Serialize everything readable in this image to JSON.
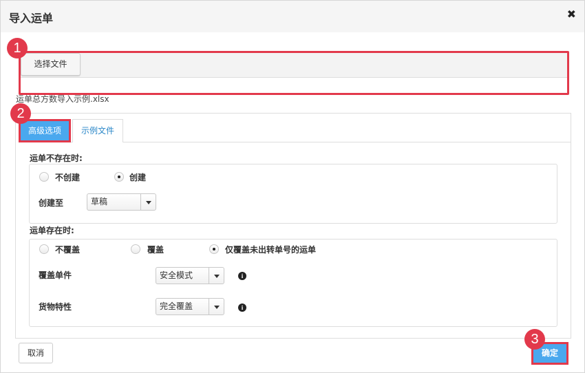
{
  "dialog": {
    "title": "导入运单",
    "close_symbol": "✖"
  },
  "file": {
    "choose_label": "选择文件",
    "file_name": "运单总方数导入示例.xlsx"
  },
  "badges": [
    "1",
    "2",
    "3"
  ],
  "tabs": [
    {
      "label": "高级选项",
      "active": true
    },
    {
      "label": "示例文件",
      "active": false
    }
  ],
  "not_exist": {
    "label": "运单不存在时:",
    "options": [
      {
        "label": "不创建",
        "checked": false
      },
      {
        "label": "创建",
        "checked": true
      }
    ],
    "create_to_label": "创建至",
    "create_to_value": "草稿"
  },
  "exist": {
    "label": "运单存在时:",
    "options": [
      {
        "label": "不覆盖",
        "checked": false
      },
      {
        "label": "覆盖",
        "checked": false
      },
      {
        "label": "仅覆盖未出转单号的运单",
        "checked": true
      }
    ],
    "cover_item_label": "覆盖单件",
    "cover_item_value": "安全模式",
    "goods_label": "货物特性",
    "goods_value": "完全覆盖"
  },
  "footer": {
    "cancel_label": "取消",
    "ok_label": "确定"
  },
  "colors": {
    "highlight": "#e2394b",
    "primary": "#4aa8ee",
    "link": "#2a87c8"
  },
  "icons": {
    "close": "close-icon",
    "info": "info-icon",
    "dropdown": "chevron-down-icon"
  }
}
